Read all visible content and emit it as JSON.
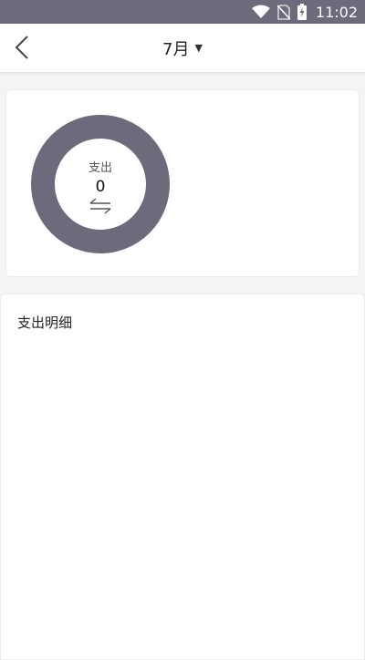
{
  "status_bar": {
    "time": "11:02",
    "background": "#6d6a7c",
    "icons": [
      "wifi-icon",
      "no-sim-icon",
      "battery-charging-icon"
    ]
  },
  "app_bar": {
    "back_icon": "chevron-left-icon",
    "month": "7月",
    "caret_icon": "caret-down-icon"
  },
  "summary": {
    "label": "支出",
    "total": "0",
    "swap_icon": "swap-arrows-icon",
    "donut_color": "#6d6a7c"
  },
  "detail": {
    "title": "支出明细"
  }
}
